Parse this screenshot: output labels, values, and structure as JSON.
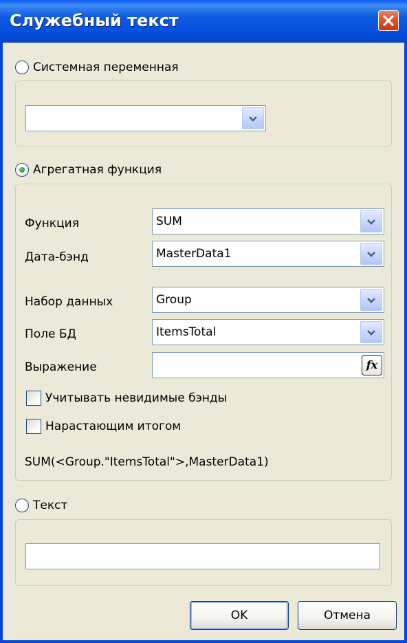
{
  "dialog": {
    "title": "Служебный текст"
  },
  "system_variable": {
    "label": "Системная переменная",
    "selected": false,
    "combo_value": ""
  },
  "aggregate": {
    "label": "Агрегатная функция",
    "selected": true,
    "function_label": "Функция",
    "function_value": "SUM",
    "databand_label": "Дата-бэнд",
    "databand_value": "MasterData1",
    "dataset_label": "Набор данных",
    "dataset_value": "Group",
    "field_label": "Поле БД",
    "field_value": "ItemsTotal",
    "expression_label": "Выражение",
    "expression_value": "",
    "expression_button": "fx",
    "count_invisible_label": "Учитывать невидимые бэнды",
    "count_invisible_checked": false,
    "running_total_label": "Нарастающим итогом",
    "running_total_checked": false,
    "result": "SUM(<Group.\"ItemsTotal\">,MasterData1)"
  },
  "text_option": {
    "label": "Текст",
    "selected": false,
    "value": ""
  },
  "buttons": {
    "ok": "OK",
    "cancel": "Отмена"
  },
  "icons": {
    "close": "close-icon",
    "dropdown": "chevron-down-icon",
    "expression": "function-fx-icon"
  },
  "colors": {
    "titlebar": "#0a5ae0",
    "dialog_bg": "#ece9d8",
    "close_button": "#d9542c",
    "radio_selected": "#21a12a",
    "input_border": "#7f9db9"
  }
}
